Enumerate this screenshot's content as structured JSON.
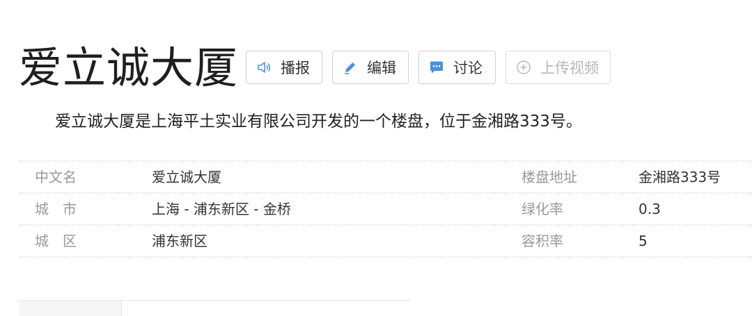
{
  "title": "爱立诚大厦",
  "buttons": [
    {
      "label": "播报",
      "icon": "speaker-icon",
      "color": "#4a90e2"
    },
    {
      "label": "编辑",
      "icon": "pencil-icon",
      "color": "#4a90e2"
    },
    {
      "label": "讨论",
      "icon": "chat-icon",
      "color": "#4a90e2"
    },
    {
      "label": "上传视频",
      "icon": "plus-circle-icon",
      "color": "#b8b8b8"
    }
  ],
  "summary": "爱立诚大厦是上海平土实业有限公司开发的一个楼盘，位于金湘路333号。",
  "basic_info": [
    {
      "k1": "中文名",
      "v1": "爱立诚大厦",
      "k2": "楼盘地址",
      "v2": "金湘路333号"
    },
    {
      "k1": "城　市",
      "v1": "上海 - 浦东新区 - 金桥",
      "k2": "绿化率",
      "v2": "0.3"
    },
    {
      "k1": "城　区",
      "v1": "浦东新区",
      "k2": "容积率",
      "v2": "5"
    }
  ]
}
